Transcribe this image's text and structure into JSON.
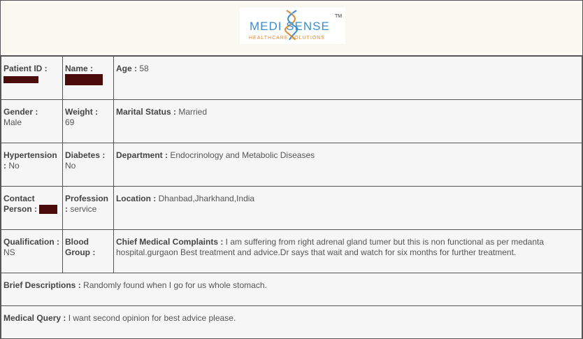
{
  "logo": {
    "brand": "MEDI SENSE",
    "tagline": "HEALTHCARE SOLUTIONS",
    "tm": "TM"
  },
  "fields": {
    "patient_id_label": "Patient ID :",
    "name_label": "Name :",
    "age_label": "Age :",
    "age_value": "58",
    "gender_label": "Gender :",
    "gender_value": "Male",
    "weight_label": "Weight :",
    "weight_value": "69",
    "marital_label": "Marital Status :",
    "marital_value": "Married",
    "hypertension_label": "Hypertension :",
    "hypertension_value": "No",
    "diabetes_label": "Diabetes :",
    "diabetes_value": "No",
    "department_label": "Department :",
    "department_value": "Endocrinology and Metabolic Diseases",
    "contact_label": "Contact Person :",
    "profession_label": "Profession :",
    "profession_value": "service",
    "location_label": "Location :",
    "location_value": "Dhanbad,Jharkhand,India",
    "qualification_label": "Qualification :",
    "qualification_value": "NS",
    "blood_label": "Blood Group :",
    "complaints_label": "Chief Medical Complaints :",
    "complaints_value": "I am suffering from right adrenal gland tumer but this is non functional as per medanta hospital.gurgaon Best treatment and advice.Dr says that wait and watch for six months for further treatment.",
    "brief_label": "Brief Descriptions :",
    "brief_value": "Randomly found when I go for us whole stomach.",
    "query_label": "Medical Query :",
    "query_value": "I want second opinion for best advice please."
  }
}
